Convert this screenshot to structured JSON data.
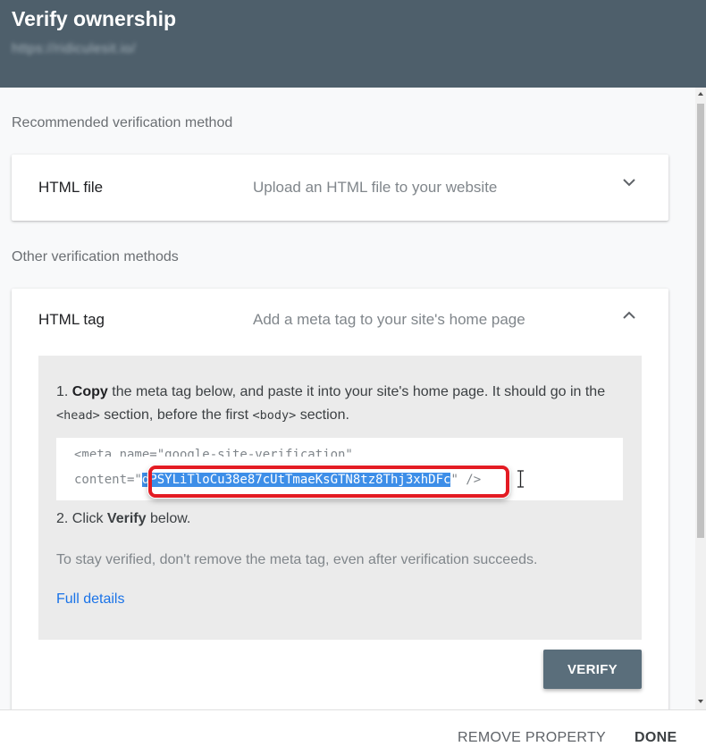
{
  "dialog": {
    "title": "Verify ownership",
    "property_url": "https://ridiculesit.io/"
  },
  "recommended": {
    "label": "Recommended verification method",
    "method": {
      "name": "HTML file",
      "description": "Upload an HTML file to your website",
      "icon": "chevron-down-icon"
    }
  },
  "other": {
    "label": "Other verification methods",
    "method": {
      "name": "HTML tag",
      "description": "Add a meta tag to your site's home page",
      "icon": "chevron-up-icon",
      "step1": {
        "number": "1.",
        "verb": "Copy",
        "text_a": "the meta tag below, and paste it into your site's home page. It should go in the",
        "head_tag": "<head>",
        "text_b": "section, before the first",
        "body_tag": "<body>",
        "text_c": "section."
      },
      "code": {
        "line1": "<meta name=\"google-site-verification\"",
        "line2_prefix": "content=\"",
        "token": "dPSYLiTloCu38e87cUtTmaeKsGTN8tz8Thj3xhDFc",
        "line2_suffix": "\" />"
      },
      "step2": {
        "number": "2.",
        "text_a": "Click",
        "verb": "Verify",
        "text_b": "below."
      },
      "note": "To stay verified, don't remove the meta tag, even after verification succeeds.",
      "link": "Full details",
      "verify_button": "VERIFY"
    }
  },
  "footer": {
    "remove": "REMOVE PROPERTY",
    "done": "DONE"
  }
}
